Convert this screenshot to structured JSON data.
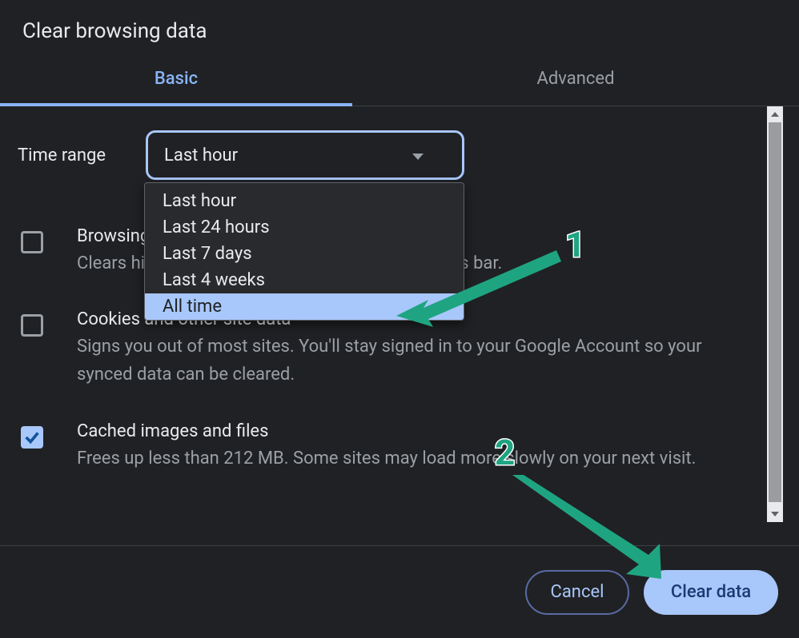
{
  "dialog": {
    "title": "Clear browsing data",
    "tabs": {
      "basic": "Basic",
      "advanced": "Advanced"
    },
    "timerange": {
      "label": "Time range",
      "selected": "Last hour",
      "options": [
        "Last hour",
        "Last 24 hours",
        "Last 7 days",
        "Last 4 weeks",
        "All time"
      ]
    },
    "options": [
      {
        "title": "Browsing history",
        "desc": "Clears history and autocompletions in the address bar.",
        "checked": false
      },
      {
        "title": "Cookies and other site data",
        "desc": "Signs you out of most sites. You'll stay signed in to your Google Account so your synced data can be cleared.",
        "checked": false
      },
      {
        "title": "Cached images and files",
        "desc": "Frees up less than 212 MB. Some sites may load more slowly on your next visit.",
        "checked": true
      }
    ],
    "buttons": {
      "cancel": "Cancel",
      "clear": "Clear data"
    }
  },
  "annotations": {
    "one": "1",
    "two": "2"
  }
}
